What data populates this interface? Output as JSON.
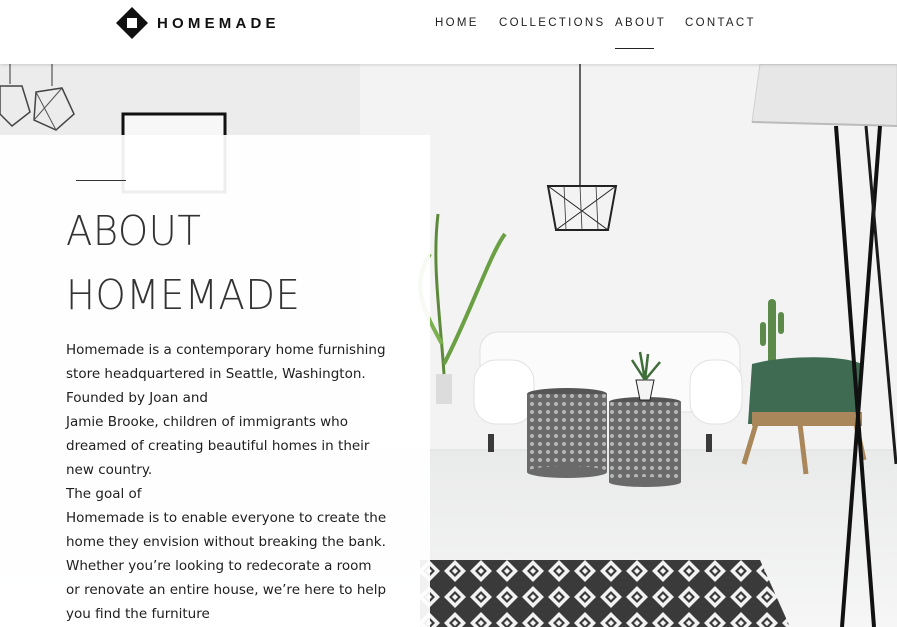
{
  "brand": {
    "name": "HOMEMADE",
    "logo_icon": "diamond-logo-icon"
  },
  "nav": {
    "items": [
      {
        "label": "HOME",
        "active": false
      },
      {
        "label": "COLLECTIONS",
        "active": false
      },
      {
        "label": "ABOUT",
        "active": true
      },
      {
        "label": "CONTACT",
        "active": false
      }
    ]
  },
  "about": {
    "title_lines": [
      "ABOUT",
      "HOMEMADE"
    ],
    "body_lines": [
      "Homemade is a contemporary home furnishing",
      "store headquartered in Seattle, Washington.",
      "Founded by Joan and",
      "Jamie Brooke, children of immigrants who",
      "dreamed of creating beautiful homes in their",
      "new country.",
      "The goal of",
      "Homemade is to enable everyone to create the",
      "home they envision without breaking the bank.",
      "Whether you’re looking to redecorate a room",
      "or renovate an entire house, we’re here to help",
      "you find the furniture"
    ]
  },
  "colors": {
    "text_dark": "#333333",
    "header_bg": "#ffffff",
    "chair_green": "#3e6b52",
    "rug_dark": "#333333"
  }
}
